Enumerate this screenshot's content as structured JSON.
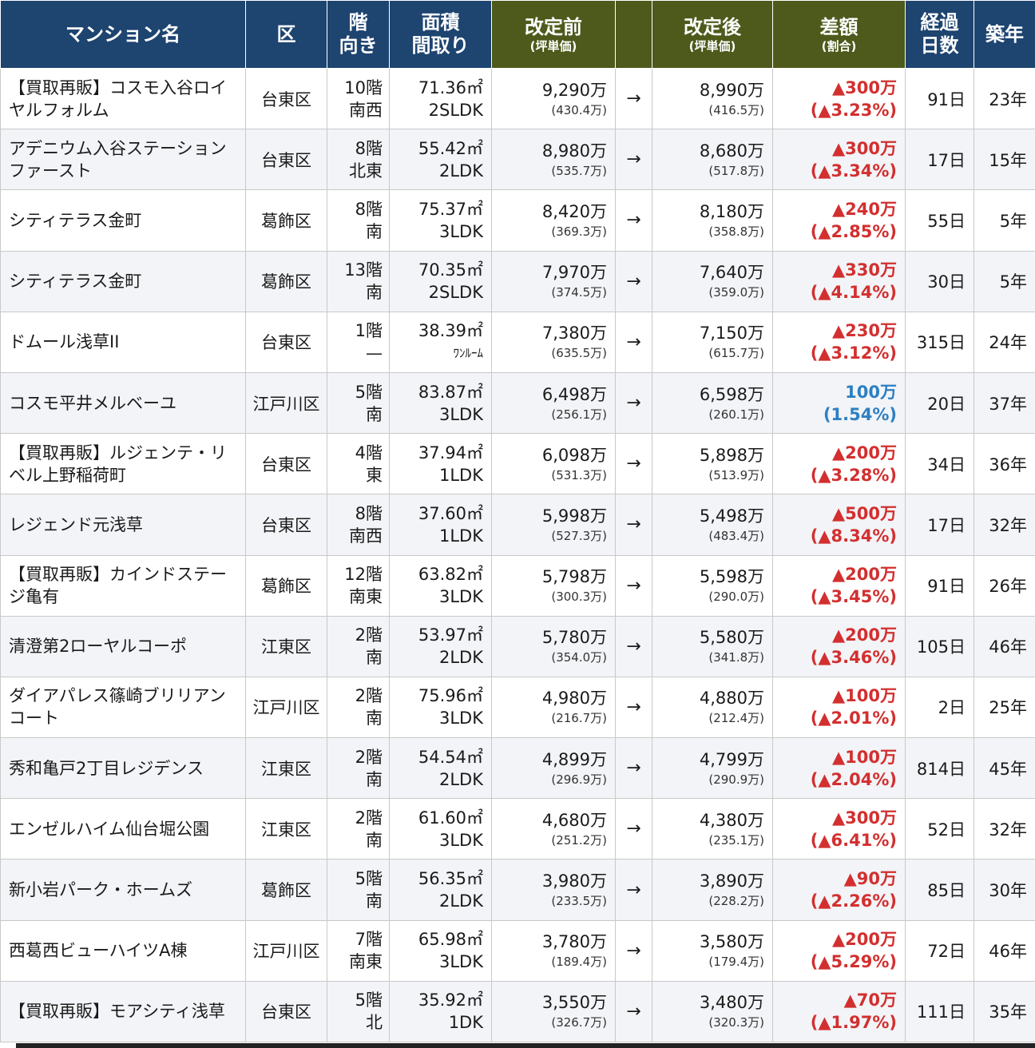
{
  "headers": {
    "name": "マンション名",
    "ward": "区",
    "floor_line1": "階",
    "floor_line2": "向き",
    "area_line1": "面積",
    "area_line2": "間取り",
    "before_main": "改定前",
    "before_sub": "(坪単価)",
    "after_main": "改定後",
    "after_sub": "(坪単価)",
    "diff_main": "差額",
    "diff_sub": "(割合)",
    "days_line1": "経過",
    "days_line2": "日数",
    "age": "築年"
  },
  "arrow_symbol": "→",
  "colors": {
    "header_navy": "#1e4470",
    "header_olive": "#4d5a1b",
    "decrease": "#d32f2f",
    "increase": "#2d7fc2"
  },
  "rows": [
    {
      "name": "【買取再販】コスモ入谷ロイヤルフォルム",
      "ward": "台東区",
      "floor": "10階",
      "facing": "南西",
      "area": "71.36㎡",
      "layout": "2SLDK",
      "before": "9,290万",
      "before_per": "(430.4万)",
      "after": "8,990万",
      "after_per": "(416.5万)",
      "diff": "▲300万",
      "pct": "(▲3.23%)",
      "dir": "down",
      "days": "91日",
      "age": "23年"
    },
    {
      "name": "アデニウム入谷ステーションファースト",
      "ward": "台東区",
      "floor": "8階",
      "facing": "北東",
      "area": "55.42㎡",
      "layout": "2LDK",
      "before": "8,980万",
      "before_per": "(535.7万)",
      "after": "8,680万",
      "after_per": "(517.8万)",
      "diff": "▲300万",
      "pct": "(▲3.34%)",
      "dir": "down",
      "days": "17日",
      "age": "15年"
    },
    {
      "name": "シティテラス金町",
      "ward": "葛飾区",
      "floor": "8階",
      "facing": "南",
      "area": "75.37㎡",
      "layout": "3LDK",
      "before": "8,420万",
      "before_per": "(369.3万)",
      "after": "8,180万",
      "after_per": "(358.8万)",
      "diff": "▲240万",
      "pct": "(▲2.85%)",
      "dir": "down",
      "days": "55日",
      "age": "5年"
    },
    {
      "name": "シティテラス金町",
      "ward": "葛飾区",
      "floor": "13階",
      "facing": "南",
      "area": "70.35㎡",
      "layout": "2SLDK",
      "before": "7,970万",
      "before_per": "(374.5万)",
      "after": "7,640万",
      "after_per": "(359.0万)",
      "diff": "▲330万",
      "pct": "(▲4.14%)",
      "dir": "down",
      "days": "30日",
      "age": "5年"
    },
    {
      "name": "ドムール浅草II",
      "ward": "台東区",
      "floor": "1階",
      "facing": "—",
      "area": "38.39㎡",
      "layout": "ﾜﾝﾙｰﾑ",
      "before": "7,380万",
      "before_per": "(635.5万)",
      "after": "7,150万",
      "after_per": "(615.7万)",
      "diff": "▲230万",
      "pct": "(▲3.12%)",
      "dir": "down",
      "days": "315日",
      "age": "24年"
    },
    {
      "name": "コスモ平井メルベーユ",
      "ward": "江戸川区",
      "floor": "5階",
      "facing": "南",
      "area": "83.87㎡",
      "layout": "3LDK",
      "before": "6,498万",
      "before_per": "(256.1万)",
      "after": "6,598万",
      "after_per": "(260.1万)",
      "diff": "100万",
      "pct": "(1.54%)",
      "dir": "up",
      "days": "20日",
      "age": "37年"
    },
    {
      "name": "【買取再販】ルジェンテ・リベル上野稲荷町",
      "ward": "台東区",
      "floor": "4階",
      "facing": "東",
      "area": "37.94㎡",
      "layout": "1LDK",
      "before": "6,098万",
      "before_per": "(531.3万)",
      "after": "5,898万",
      "after_per": "(513.9万)",
      "diff": "▲200万",
      "pct": "(▲3.28%)",
      "dir": "down",
      "days": "34日",
      "age": "36年"
    },
    {
      "name": "レジェンド元浅草",
      "ward": "台東区",
      "floor": "8階",
      "facing": "南西",
      "area": "37.60㎡",
      "layout": "1LDK",
      "before": "5,998万",
      "before_per": "(527.3万)",
      "after": "5,498万",
      "after_per": "(483.4万)",
      "diff": "▲500万",
      "pct": "(▲8.34%)",
      "dir": "down",
      "days": "17日",
      "age": "32年"
    },
    {
      "name": "【買取再販】カインドステージ亀有",
      "ward": "葛飾区",
      "floor": "12階",
      "facing": "南東",
      "area": "63.82㎡",
      "layout": "3LDK",
      "before": "5,798万",
      "before_per": "(300.3万)",
      "after": "5,598万",
      "after_per": "(290.0万)",
      "diff": "▲200万",
      "pct": "(▲3.45%)",
      "dir": "down",
      "days": "91日",
      "age": "26年"
    },
    {
      "name": "清澄第2ローヤルコーポ",
      "ward": "江東区",
      "floor": "2階",
      "facing": "南",
      "area": "53.97㎡",
      "layout": "2LDK",
      "before": "5,780万",
      "before_per": "(354.0万)",
      "after": "5,580万",
      "after_per": "(341.8万)",
      "diff": "▲200万",
      "pct": "(▲3.46%)",
      "dir": "down",
      "days": "105日",
      "age": "46年"
    },
    {
      "name": "ダイアパレス篠崎ブリリアンコート",
      "ward": "江戸川区",
      "floor": "2階",
      "facing": "南",
      "area": "75.96㎡",
      "layout": "3LDK",
      "before": "4,980万",
      "before_per": "(216.7万)",
      "after": "4,880万",
      "after_per": "(212.4万)",
      "diff": "▲100万",
      "pct": "(▲2.01%)",
      "dir": "down",
      "days": "2日",
      "age": "25年"
    },
    {
      "name": "秀和亀戸2丁目レジデンス",
      "ward": "江東区",
      "floor": "2階",
      "facing": "南",
      "area": "54.54㎡",
      "layout": "2LDK",
      "before": "4,899万",
      "before_per": "(296.9万)",
      "after": "4,799万",
      "after_per": "(290.9万)",
      "diff": "▲100万",
      "pct": "(▲2.04%)",
      "dir": "down",
      "days": "814日",
      "age": "45年"
    },
    {
      "name": "エンゼルハイム仙台堀公園",
      "ward": "江東区",
      "floor": "2階",
      "facing": "南",
      "area": "61.60㎡",
      "layout": "3LDK",
      "before": "4,680万",
      "before_per": "(251.2万)",
      "after": "4,380万",
      "after_per": "(235.1万)",
      "diff": "▲300万",
      "pct": "(▲6.41%)",
      "dir": "down",
      "days": "52日",
      "age": "32年"
    },
    {
      "name": "新小岩パーク・ホームズ",
      "ward": "葛飾区",
      "floor": "5階",
      "facing": "南",
      "area": "56.35㎡",
      "layout": "2LDK",
      "before": "3,980万",
      "before_per": "(233.5万)",
      "after": "3,890万",
      "after_per": "(228.2万)",
      "diff": "▲90万",
      "pct": "(▲2.26%)",
      "dir": "down",
      "days": "85日",
      "age": "30年"
    },
    {
      "name": "西葛西ビューハイツA棟",
      "ward": "江戸川区",
      "floor": "7階",
      "facing": "南東",
      "area": "65.98㎡",
      "layout": "3LDK",
      "before": "3,780万",
      "before_per": "(189.4万)",
      "after": "3,580万",
      "after_per": "(179.4万)",
      "diff": "▲200万",
      "pct": "(▲5.29%)",
      "dir": "down",
      "days": "72日",
      "age": "46年"
    },
    {
      "name": "【買取再販】モアシティ浅草",
      "ward": "台東区",
      "floor": "5階",
      "facing": "北",
      "area": "35.92㎡",
      "layout": "1DK",
      "before": "3,550万",
      "before_per": "(326.7万)",
      "after": "3,480万",
      "after_per": "(320.3万)",
      "diff": "▲70万",
      "pct": "(▲1.97%)",
      "dir": "down",
      "days": "111日",
      "age": "35年"
    }
  ]
}
